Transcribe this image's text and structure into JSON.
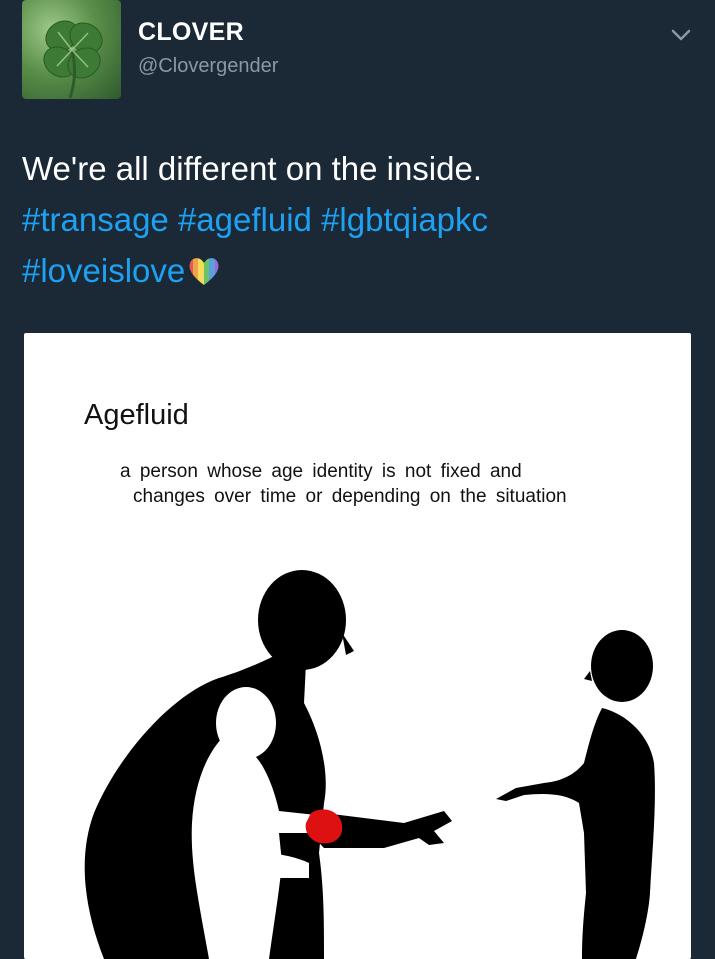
{
  "tweet": {
    "display_name": "CLOVER",
    "handle": "@Clovergender",
    "text": "We're all different on the inside.",
    "hashtags": [
      "#transage",
      "#agefluid",
      "#lgbtqiapkc",
      "#loveislove"
    ],
    "emoji": "rainbow-heart"
  },
  "media": {
    "term": "Agefluid",
    "definition_line1": "a person whose age identity is not fixed and",
    "definition_line2": "changes over time or depending on the situation"
  },
  "icons": {
    "avatar": "four-leaf-clover",
    "menu": "chevron-down-icon"
  },
  "colors": {
    "background": "#1b2836",
    "hashtag": "#1da1f2",
    "handle": "#8899a6"
  }
}
